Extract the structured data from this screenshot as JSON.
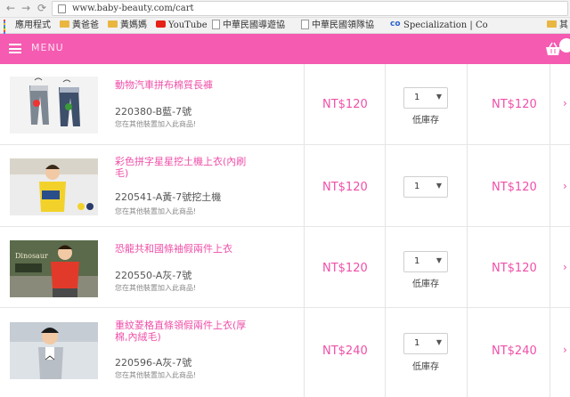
{
  "browser": {
    "url": "www.baby-beauty.com/cart"
  },
  "bookmarks": [
    {
      "label": "應用程式",
      "icon": "apps-icon"
    },
    {
      "label": "黃爸爸",
      "icon": "folder-icon"
    },
    {
      "label": "黃媽媽",
      "icon": "folder-icon"
    },
    {
      "label": "YouTube",
      "icon": "youtube-icon"
    },
    {
      "label": "中華民國導遊協",
      "icon": "page-icon"
    },
    {
      "label": "中華民國領隊協",
      "icon": "page-icon"
    },
    {
      "label": "Specialization | Co",
      "icon": "coursera-icon"
    },
    {
      "label": "其",
      "icon": "folder-icon"
    }
  ],
  "header": {
    "menu_label": "MENU",
    "accent_color": "#f45bb1"
  },
  "cart": {
    "items": [
      {
        "name": "動物汽車拼布棉質長褲",
        "sku": "220380-B藍-7號",
        "note": "您在其他裝置加入此商品!",
        "price": "NT$120",
        "quantity": "1",
        "stock_status": "低庫存",
        "subtotal": "NT$120"
      },
      {
        "name": "彩色拼字星星挖土機上衣(內刷毛)",
        "sku": "220541-A黃-7號挖土機",
        "note": "您在其他裝置加入此商品!",
        "price": "NT$120",
        "quantity": "1",
        "stock_status": "",
        "subtotal": "NT$120"
      },
      {
        "name": "恐龍共和國條袖假兩件上衣",
        "sku": "220550-A灰-7號",
        "note": "您在其他裝置加入此商品!",
        "price": "NT$120",
        "quantity": "1",
        "stock_status": "低庫存",
        "subtotal": "NT$120"
      },
      {
        "name": "重紋菱格直條領假兩件上衣(厚棉,內絨毛)",
        "sku": "220596-A灰-7號",
        "note": "您在其他裝置加入此商品!",
        "price": "NT$240",
        "quantity": "1",
        "stock_status": "低庫存",
        "subtotal": "NT$240"
      }
    ]
  }
}
